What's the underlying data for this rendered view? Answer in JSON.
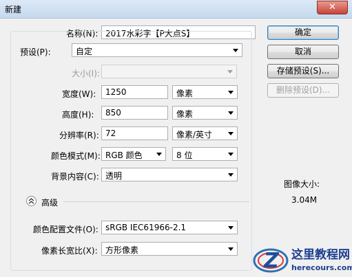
{
  "window": {
    "title": "新建"
  },
  "form": {
    "name_label": "名称(N):",
    "name_value": "2017水彩字【P大点S】",
    "preset_label": "预设(P):",
    "preset_value": "自定",
    "size_label": "大小(I):",
    "size_value": "",
    "width_label": "宽度(W):",
    "width_value": "1250",
    "width_unit": "像素",
    "height_label": "高度(H):",
    "height_value": "850",
    "height_unit": "像素",
    "resolution_label": "分辨率(R):",
    "resolution_value": "72",
    "resolution_unit": "像素/英寸",
    "color_mode_label": "颜色模式(M):",
    "color_mode_value": "RGB 颜色",
    "bit_depth_value": "8 位",
    "background_label": "背景内容(C):",
    "background_value": "透明",
    "advanced_label": "高级",
    "color_profile_label": "颜色配置文件(O):",
    "color_profile_value": "sRGB IEC61966-2.1",
    "pixel_aspect_label": "像素长宽比(X):",
    "pixel_aspect_value": "方形像素"
  },
  "buttons": {
    "ok": "确定",
    "cancel": "取消",
    "save_preset": "存储预设(S)...",
    "delete_preset": "删除预设(D)..."
  },
  "image_size": {
    "label": "图像大小:",
    "value": "3.04M"
  },
  "watermark": {
    "title": "这里教程网",
    "url": "herecours.com"
  },
  "icons": {
    "close": "close-icon",
    "dropdown": "chevron-down-icon",
    "collapse": "double-chevron-up-icon"
  }
}
